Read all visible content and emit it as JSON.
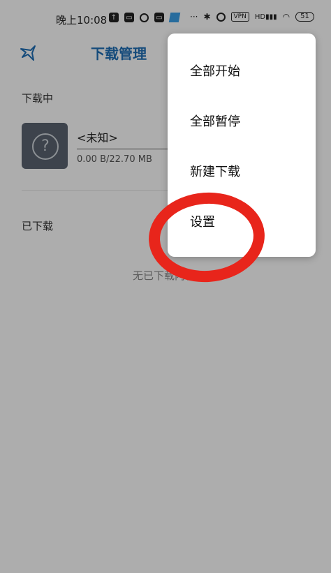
{
  "status_bar": {
    "time": "晚上10:08",
    "icons": [
      "upload-icon",
      "notification-icon",
      "alarm-icon",
      "notification-icon",
      "app-icon"
    ],
    "dots": "···",
    "right_icons": [
      "bluetooth-icon",
      "alarm-icon",
      "vpn-badge",
      "signal-icon",
      "wifi-icon",
      "battery-icon"
    ],
    "vpn_label": "VPN",
    "signal_label": "HD",
    "battery_level": "51"
  },
  "toolbar": {
    "back_icon": "bird-back-icon",
    "title": "下载管理"
  },
  "downloading": {
    "section_label": "下载中",
    "items": [
      {
        "name": "<未知>",
        "size": "0.00 B/22.70 MB",
        "thumb_icon": "question-mark-icon",
        "progress": 0
      }
    ]
  },
  "downloaded": {
    "section_label": "已下载",
    "empty_text": "无已下载内容"
  },
  "menu": {
    "items": [
      {
        "label": "全部开始"
      },
      {
        "label": "全部暂停"
      },
      {
        "label": "新建下载"
      },
      {
        "label": "设置"
      }
    ]
  },
  "annotation": {
    "color": "#e8251b",
    "target": "设置"
  },
  "colors": {
    "title_blue": "#1f6fb6",
    "scrim": "rgba(0,0,0,0.32)"
  }
}
